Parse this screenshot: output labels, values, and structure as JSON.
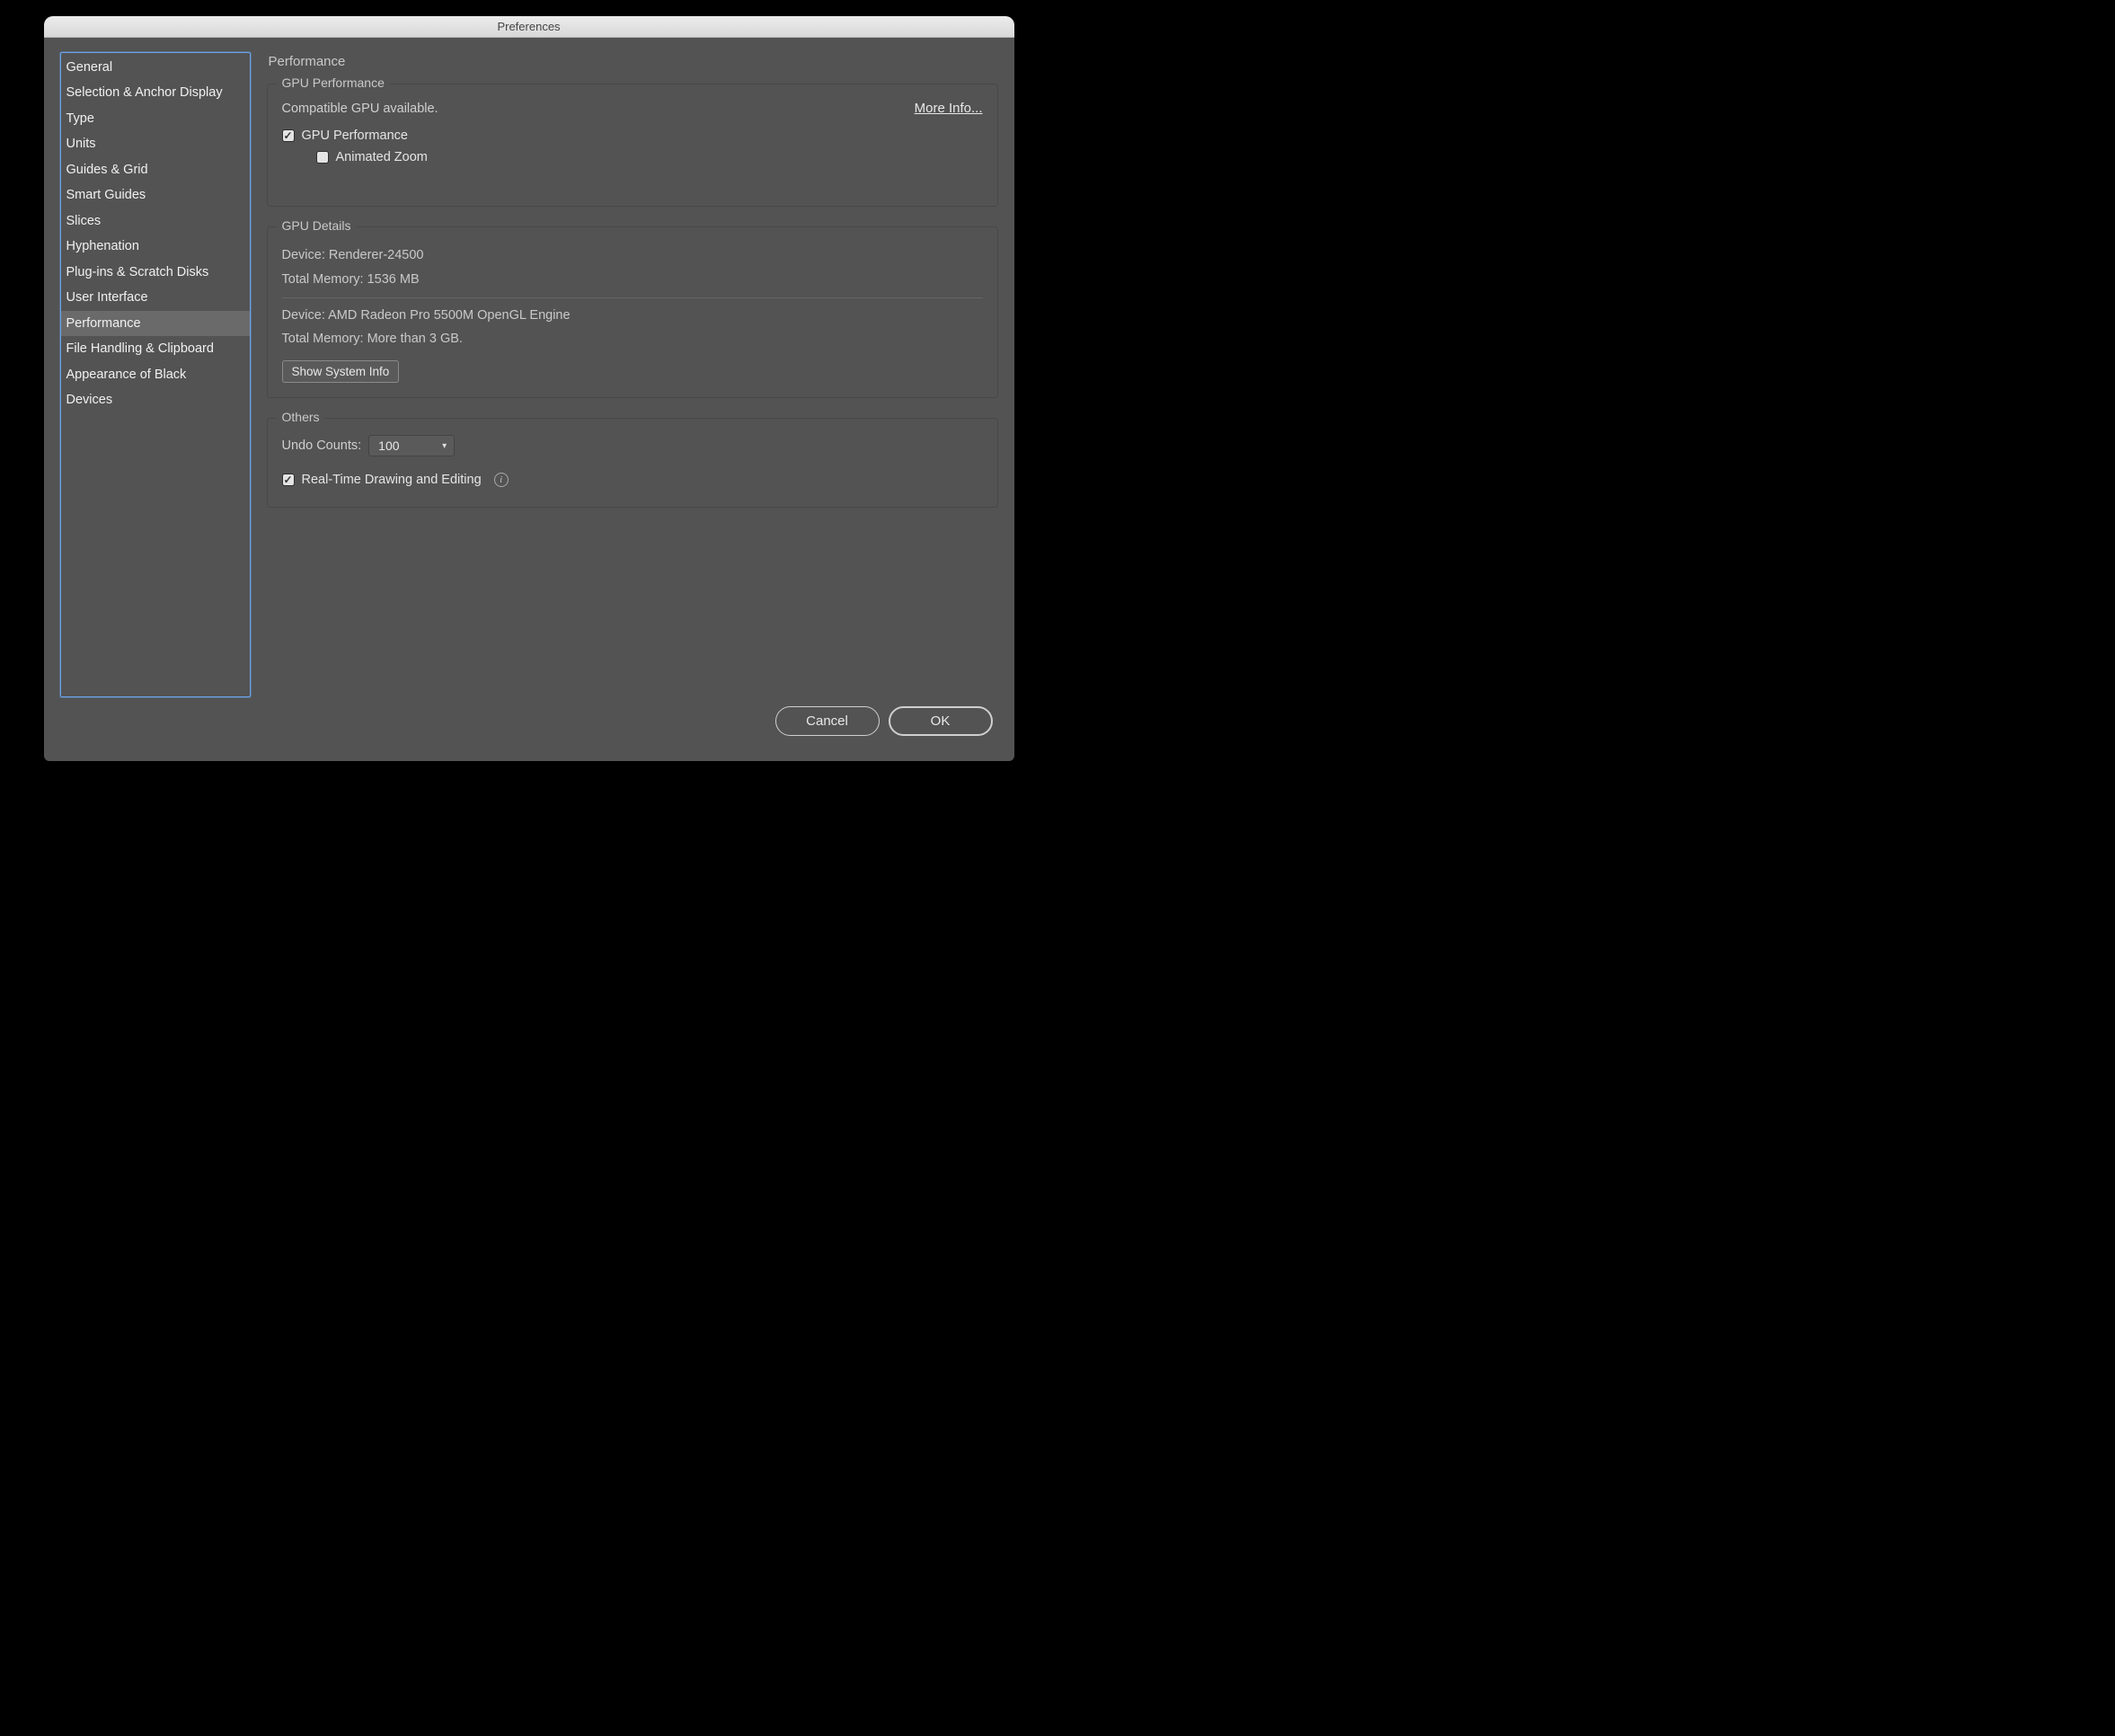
{
  "window": {
    "title": "Preferences"
  },
  "sidebar": {
    "items": [
      {
        "label": "General",
        "selected": false
      },
      {
        "label": "Selection & Anchor Display",
        "selected": false
      },
      {
        "label": "Type",
        "selected": false
      },
      {
        "label": "Units",
        "selected": false
      },
      {
        "label": "Guides & Grid",
        "selected": false
      },
      {
        "label": "Smart Guides",
        "selected": false
      },
      {
        "label": "Slices",
        "selected": false
      },
      {
        "label": "Hyphenation",
        "selected": false
      },
      {
        "label": "Plug-ins & Scratch Disks",
        "selected": false
      },
      {
        "label": "User Interface",
        "selected": false
      },
      {
        "label": "Performance",
        "selected": true
      },
      {
        "label": "File Handling & Clipboard",
        "selected": false
      },
      {
        "label": "Appearance of Black",
        "selected": false
      },
      {
        "label": "Devices",
        "selected": false
      }
    ]
  },
  "main": {
    "title": "Performance",
    "gpu_perf": {
      "group_title": "GPU Performance",
      "compat_text": "Compatible GPU available.",
      "more_info": "More Info...",
      "gpu_checkbox_label": "GPU Performance",
      "gpu_checked": true,
      "anim_zoom_label": "Animated Zoom",
      "anim_zoom_checked": false
    },
    "gpu_details": {
      "group_title": "GPU Details",
      "device1": "Device: Renderer-24500",
      "mem1": "Total Memory: 1536 MB",
      "device2": "Device: AMD Radeon Pro 5500M OpenGL Engine",
      "mem2": "Total Memory:  More than 3 GB.",
      "show_sys_info": "Show System Info"
    },
    "others": {
      "group_title": "Others",
      "undo_label": "Undo Counts:",
      "undo_value": "100",
      "realtime_label": "Real-Time Drawing and Editing",
      "realtime_checked": true
    }
  },
  "footer": {
    "cancel": "Cancel",
    "ok": "OK"
  }
}
